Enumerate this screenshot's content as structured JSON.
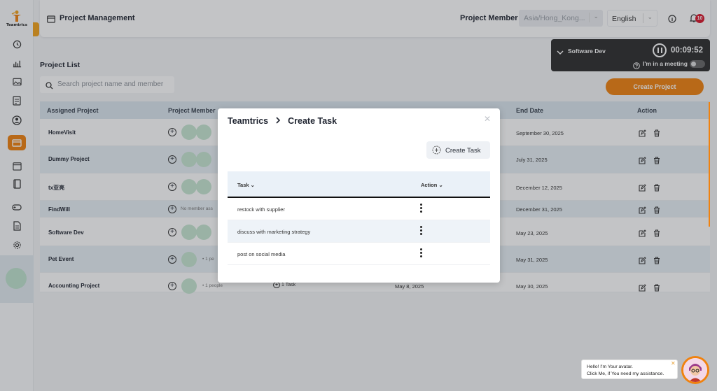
{
  "app": {
    "logo_text": "Teamtrics"
  },
  "header": {
    "title": "Project Management",
    "member_label": "Project Member",
    "timezone_value": "Asia/Hong_Kong...",
    "language_value": "English",
    "notification_count": "10"
  },
  "timer": {
    "project": "Software Dev",
    "time": "00:09:52",
    "meeting_label": "I'm in a meeting"
  },
  "page": {
    "section_title": "Project List",
    "search_placeholder": "Search project name and member",
    "create_project_label": "Create Project"
  },
  "table": {
    "headers": {
      "assigned": "Assigned Project",
      "member": "Project Member",
      "end": "End Date",
      "action": "Action"
    },
    "rows": [
      {
        "name": "HomeVisit",
        "end": "September 30, 2025"
      },
      {
        "name": "Dummy Project",
        "end": "July 31, 2025"
      },
      {
        "name": "tx亚亮",
        "end": "December 12, 2025"
      },
      {
        "name": "FindWill",
        "no_member": "No member ass",
        "end": "December 31, 2025"
      },
      {
        "name": "Software Dev",
        "end": "May 23, 2025"
      },
      {
        "name": "Pet Event",
        "people": "• 1 pe",
        "end": "May 31, 2025"
      },
      {
        "name": "Accounting Project",
        "people": "• 1 people",
        "task": "1 Task",
        "start": "May 8, 2025",
        "end": "May 30, 2025"
      }
    ]
  },
  "modal": {
    "crumb_root": "Teamtrics",
    "crumb_current": "Create Task",
    "create_task_label": "Create Task",
    "col_task": "Task",
    "col_action": "Action",
    "tasks": [
      "restock with supplier",
      "discuss with marketing strategy",
      "post on social media"
    ]
  },
  "assistant": {
    "line1": "Hello! I'm Your avatar.",
    "line2": "Click Me, if You need my assistance."
  },
  "colors": {
    "accent": "#f0820f",
    "dark_panel": "#2d2d2d",
    "badge": "#d8152a",
    "row_alt": "#e8f0f5"
  }
}
